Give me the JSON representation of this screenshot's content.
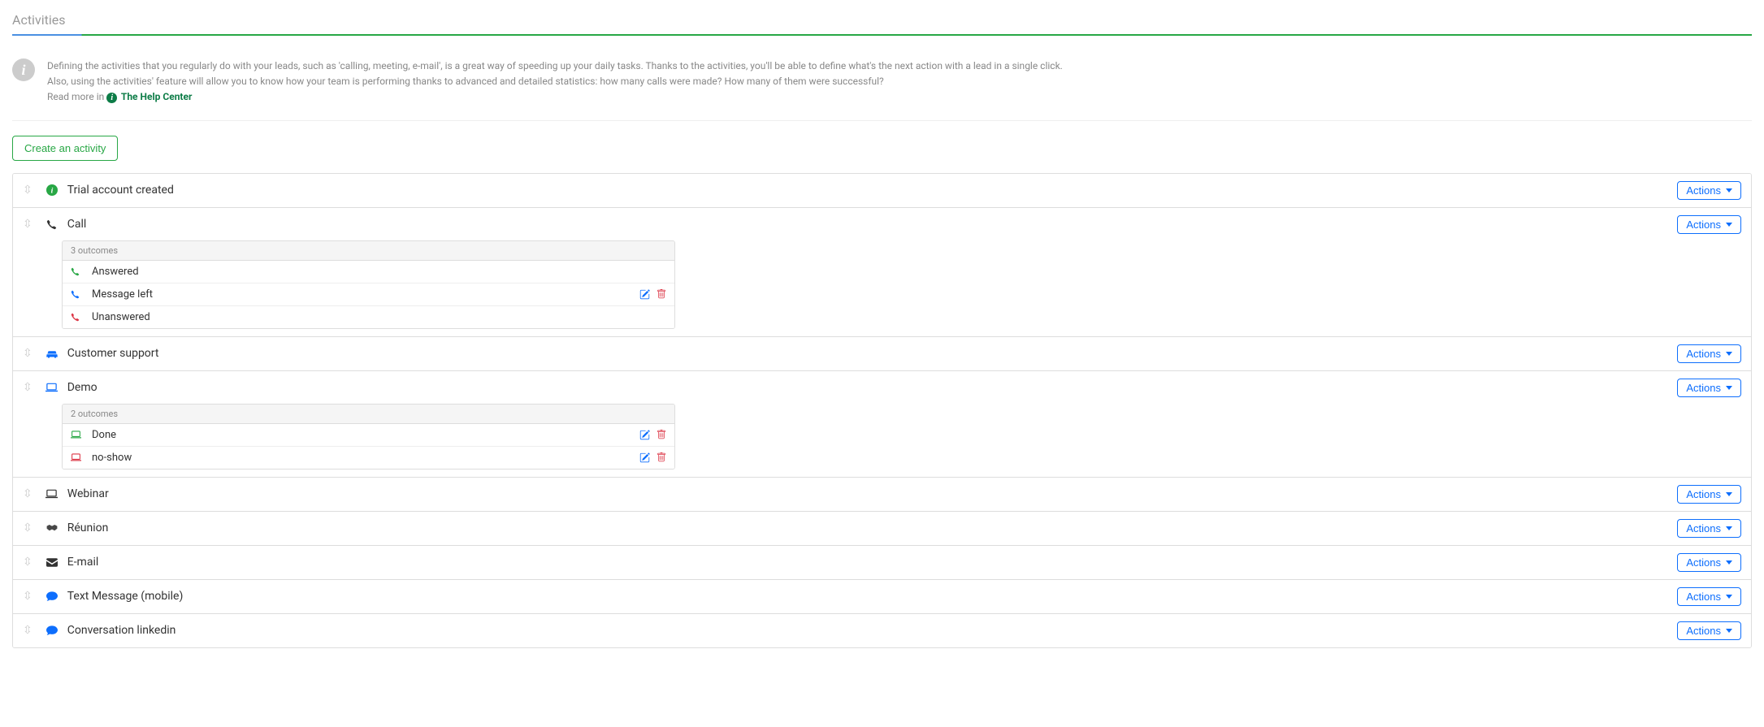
{
  "page": {
    "title": "Activities"
  },
  "info": {
    "line1": "Defining the activities that you regularly do with your leads, such as 'calling, meeting, e-mail', is a great way of speeding up your daily tasks. Thanks to the activities, you'll be able to define what's the next action with a lead in a single click.",
    "line2": "Also, using the activities' feature will allow you to know how your team is performing thanks to advanced and detailed statistics: how many calls were made? How many of them were successful?",
    "read_more_prefix": "Read more in ",
    "help_link": "The Help Center"
  },
  "buttons": {
    "create": "Create an activity",
    "actions": "Actions"
  },
  "activities": [
    {
      "name": "Trial account created",
      "icon": "info-green",
      "outcomes": null
    },
    {
      "name": "Call",
      "icon": "phone-black",
      "outcomes_label": "3 outcomes",
      "outcomes": [
        {
          "name": "Answered",
          "icon": "phone-green",
          "show_actions": false
        },
        {
          "name": "Message left",
          "icon": "phone-blue",
          "show_actions": true
        },
        {
          "name": "Unanswered",
          "icon": "phone-red",
          "show_actions": false
        }
      ]
    },
    {
      "name": "Customer support",
      "icon": "car-blue",
      "outcomes": null
    },
    {
      "name": "Demo",
      "icon": "laptop-blue",
      "outcomes_label": "2 outcomes",
      "outcomes": [
        {
          "name": "Done",
          "icon": "laptop-green",
          "show_actions": true
        },
        {
          "name": "no-show",
          "icon": "laptop-red",
          "show_actions": true
        }
      ]
    },
    {
      "name": "Webinar",
      "icon": "laptop-black",
      "outcomes": null
    },
    {
      "name": "Réunion",
      "icon": "handshake-black",
      "outcomes": null
    },
    {
      "name": "E-mail",
      "icon": "envelope-black",
      "outcomes": null
    },
    {
      "name": "Text Message (mobile)",
      "icon": "comment-blue",
      "outcomes": null
    },
    {
      "name": "Conversation linkedin",
      "icon": "comment-blue",
      "outcomes": null
    }
  ]
}
